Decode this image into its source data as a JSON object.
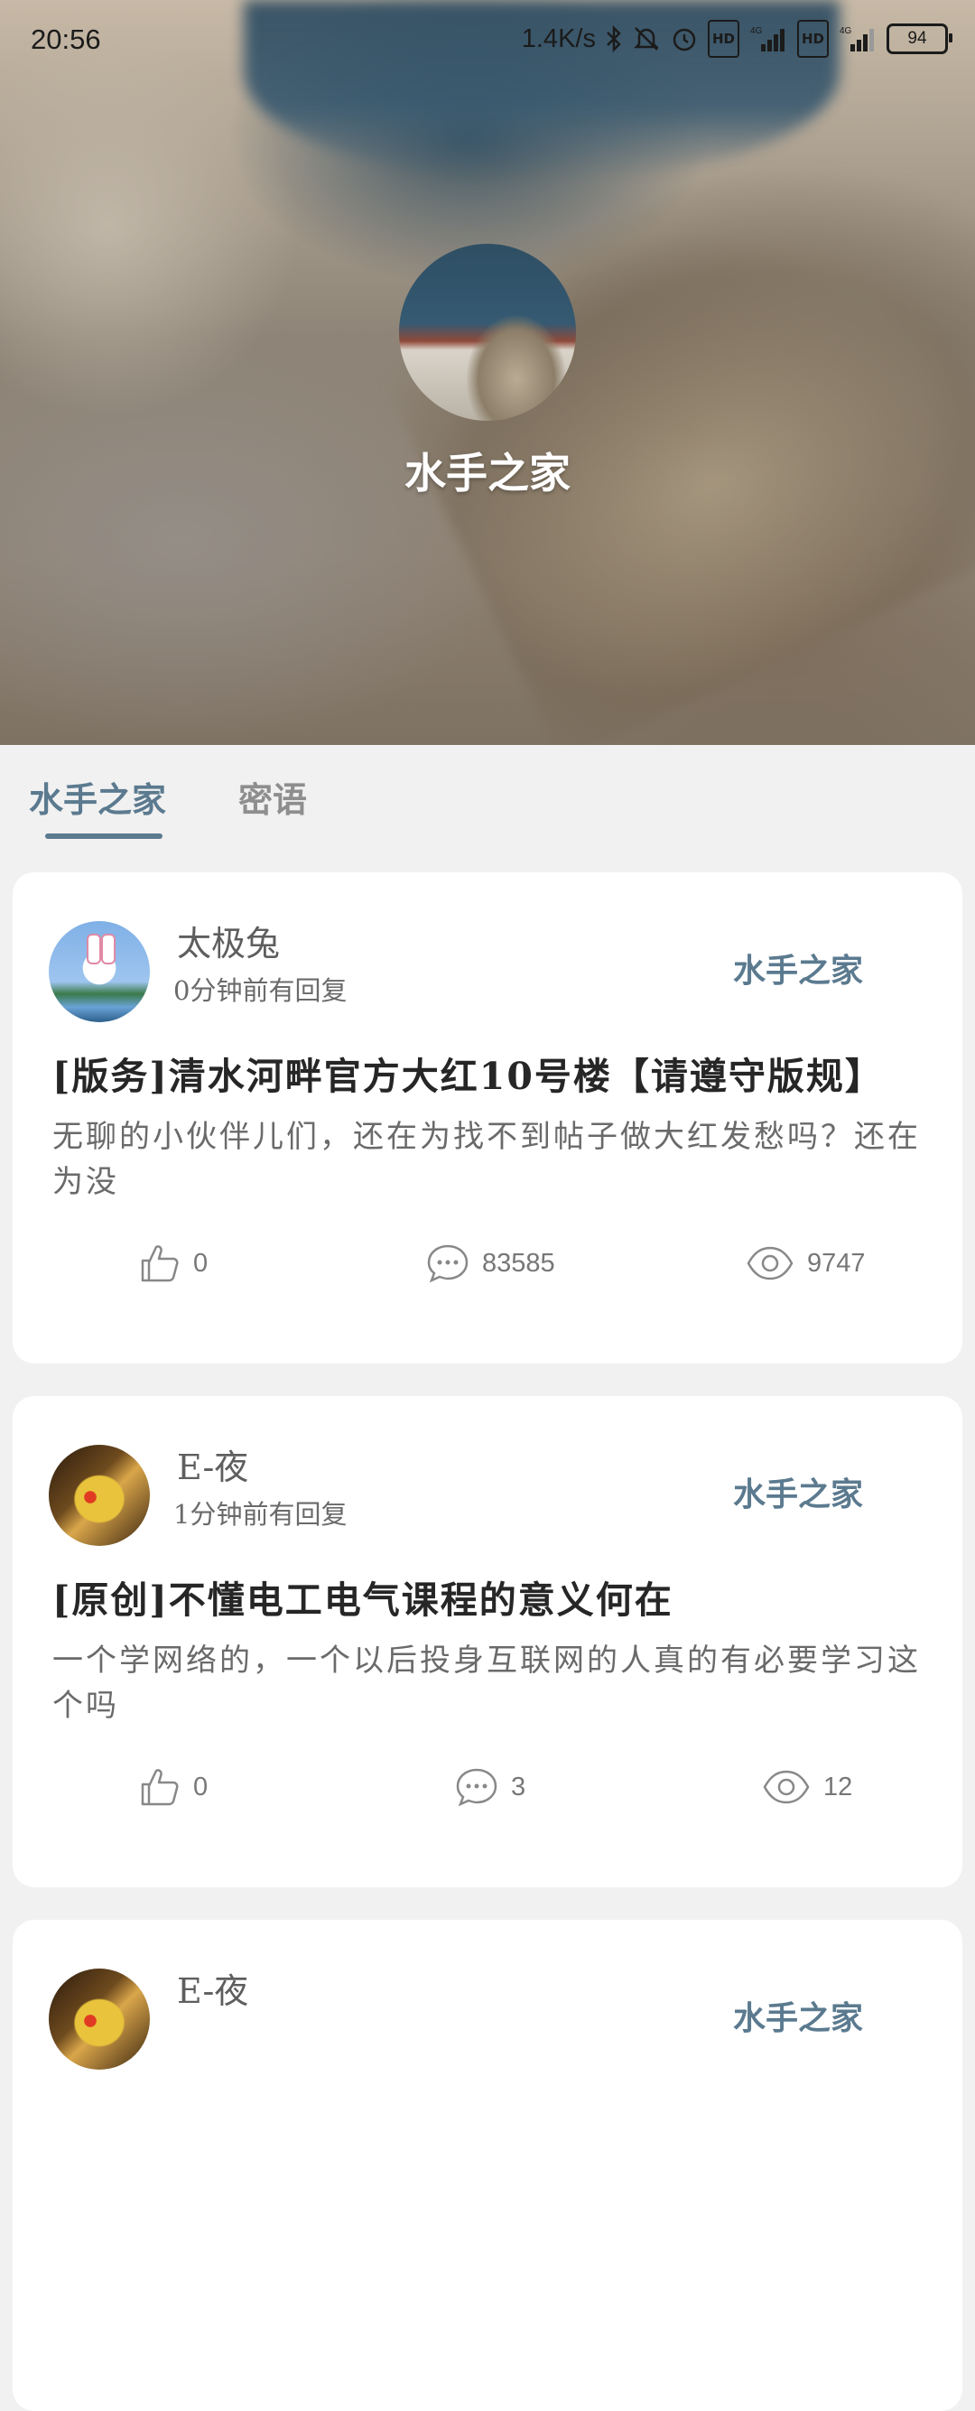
{
  "status_bar": {
    "time": "20:56",
    "net_speed": "1.4K/s",
    "hd1": "HD",
    "hd2": "HD",
    "net_type1": "4G",
    "net_type2": "4G",
    "battery": "94"
  },
  "group": {
    "title": "水手之家"
  },
  "tabs": [
    {
      "label": "水手之家",
      "active": true
    },
    {
      "label": "密语",
      "active": false
    }
  ],
  "posts": [
    {
      "author": "太极兔",
      "time": "0分钟前有回复",
      "board": "水手之家",
      "title": "[版务]清水河畔官方大红10号楼【请遵守版规】",
      "excerpt": "无聊的小伙伴儿们，还在为找不到帖子做大红发愁吗？还在为没",
      "likes": "0",
      "comments": "83585",
      "views": "9747"
    },
    {
      "author": "E-夜",
      "time": "1分钟前有回复",
      "board": "水手之家",
      "title": "[原创]不懂电工电气课程的意义何在",
      "excerpt": "一个学网络的，一个以后投身互联网的人真的有必要学习这个吗",
      "likes": "0",
      "comments": "3",
      "views": "12"
    },
    {
      "author": "E-夜",
      "board": "水手之家"
    }
  ],
  "colors": {
    "accent": "#5b7a8f",
    "page_bg": "#f1f1f1",
    "card_bg": "#ffffff"
  },
  "icons": [
    "thumbs-up-icon",
    "comment-icon",
    "eye-icon",
    "bluetooth-icon",
    "bell-off-icon",
    "alarm-icon",
    "signal-icon",
    "battery-icon"
  ]
}
